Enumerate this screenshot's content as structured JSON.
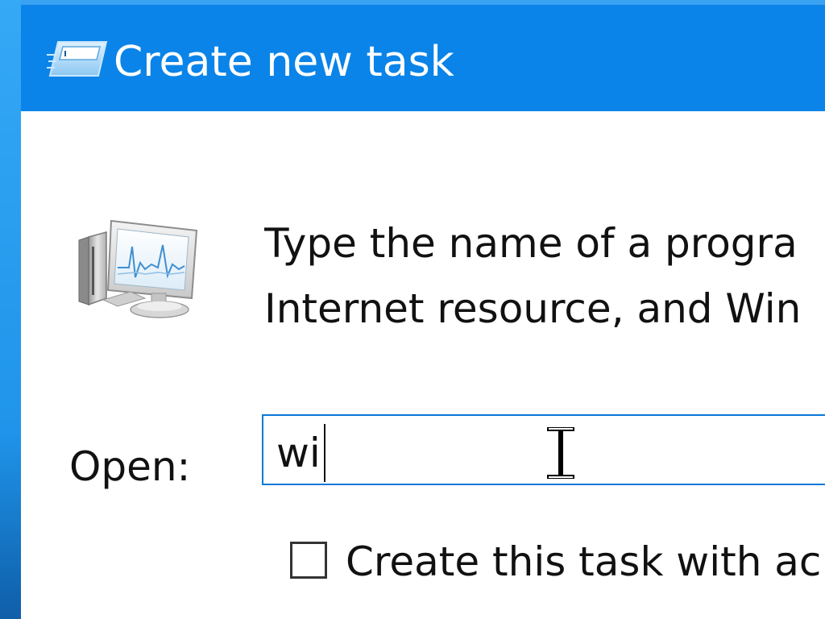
{
  "window": {
    "title": "Create new task",
    "title_icon": "run-dialog-icon",
    "titlebar_color": "#0a84e8"
  },
  "body": {
    "app_icon": "task-manager-monitor-icon",
    "description_lines": [
      "Type the name of a progra",
      "Internet resource, and Win"
    ]
  },
  "open_field": {
    "label": "Open:",
    "value": "wi",
    "border_color": "#0a78d7"
  },
  "admin_checkbox": {
    "checked": false,
    "label": "Create this task with ac"
  },
  "cursor": {
    "icon": "text-ibeam-cursor-icon"
  }
}
